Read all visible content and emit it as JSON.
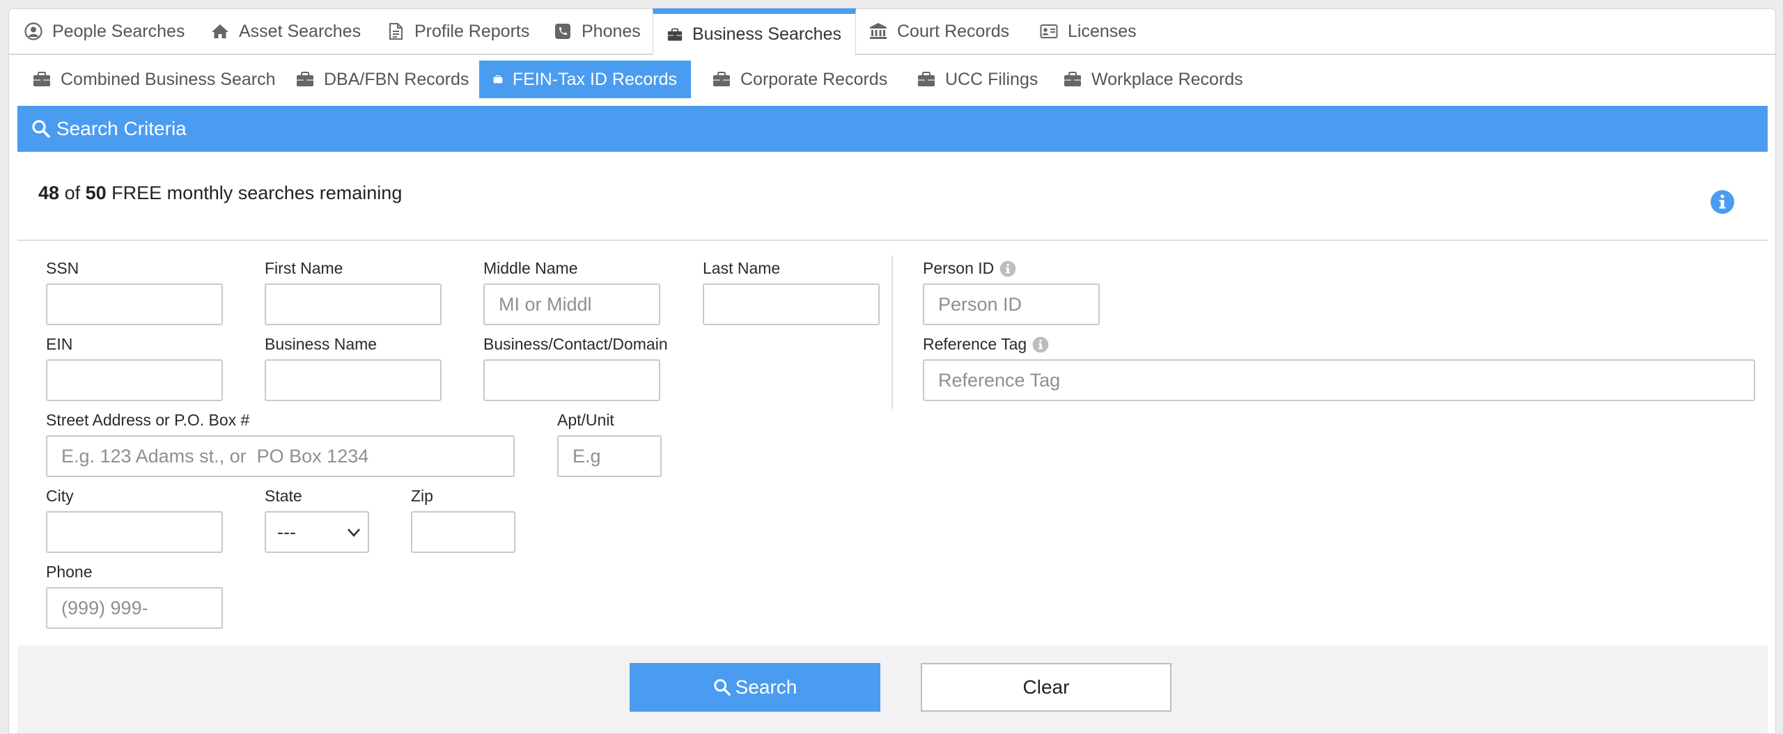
{
  "top_tabs": [
    {
      "label": "People Searches",
      "icon": "user-circle-icon"
    },
    {
      "label": "Asset Searches",
      "icon": "home-icon"
    },
    {
      "label": "Profile Reports",
      "icon": "document-icon"
    },
    {
      "label": "Phones",
      "icon": "phone-icon"
    },
    {
      "label": "Business Searches",
      "icon": "briefcase-icon",
      "active": true
    },
    {
      "label": "Court Records",
      "icon": "courthouse-icon"
    },
    {
      "label": "Licenses",
      "icon": "id-card-icon"
    }
  ],
  "sub_tabs": [
    {
      "label": "Combined Business Search",
      "icon": "briefcase-icon"
    },
    {
      "label": "DBA/FBN Records",
      "icon": "briefcase-icon"
    },
    {
      "label": "FEIN-Tax ID Records",
      "icon": "briefcase-icon",
      "active": true
    },
    {
      "label": "Corporate Records",
      "icon": "briefcase-icon"
    },
    {
      "label": "UCC Filings",
      "icon": "briefcase-icon"
    },
    {
      "label": "Workplace Records",
      "icon": "briefcase-icon"
    }
  ],
  "panel": {
    "title": "Search Criteria",
    "quota_used": "48",
    "quota_of": "of",
    "quota_total": "50",
    "quota_text": "FREE monthly searches remaining"
  },
  "form": {
    "ssn": {
      "label": "SSN",
      "value": "",
      "placeholder": ""
    },
    "first_name": {
      "label": "First Name",
      "value": "",
      "placeholder": ""
    },
    "middle_name": {
      "label": "Middle Name",
      "value": "",
      "placeholder": "MI or Middl"
    },
    "last_name": {
      "label": "Last Name",
      "value": "",
      "placeholder": ""
    },
    "person_id": {
      "label": "Person ID",
      "value": "",
      "placeholder": "Person ID"
    },
    "ein": {
      "label": "EIN",
      "value": "",
      "placeholder": ""
    },
    "business_name": {
      "label": "Business Name",
      "value": "",
      "placeholder": ""
    },
    "business_contact_domain": {
      "label": "Business/Contact/Domain",
      "value": "",
      "placeholder": ""
    },
    "reference_tag": {
      "label": "Reference Tag",
      "value": "",
      "placeholder": "Reference Tag"
    },
    "street": {
      "label": "Street Address or P.O. Box #",
      "value": "",
      "placeholder": "E.g. 123 Adams st., or  PO Box 1234"
    },
    "apt": {
      "label": "Apt/Unit",
      "value": "",
      "placeholder": "E.g"
    },
    "city": {
      "label": "City",
      "value": "",
      "placeholder": ""
    },
    "state": {
      "label": "State",
      "selected": "---"
    },
    "zip": {
      "label": "Zip",
      "value": "",
      "placeholder": ""
    },
    "phone": {
      "label": "Phone",
      "value": "",
      "placeholder": "(999) 999-"
    }
  },
  "buttons": {
    "search": "Search",
    "clear": "Clear"
  },
  "colors": {
    "accent": "#4a9cf0",
    "info_icon": "#4a9cf0",
    "info_icon_small": "#bdbdbd"
  }
}
